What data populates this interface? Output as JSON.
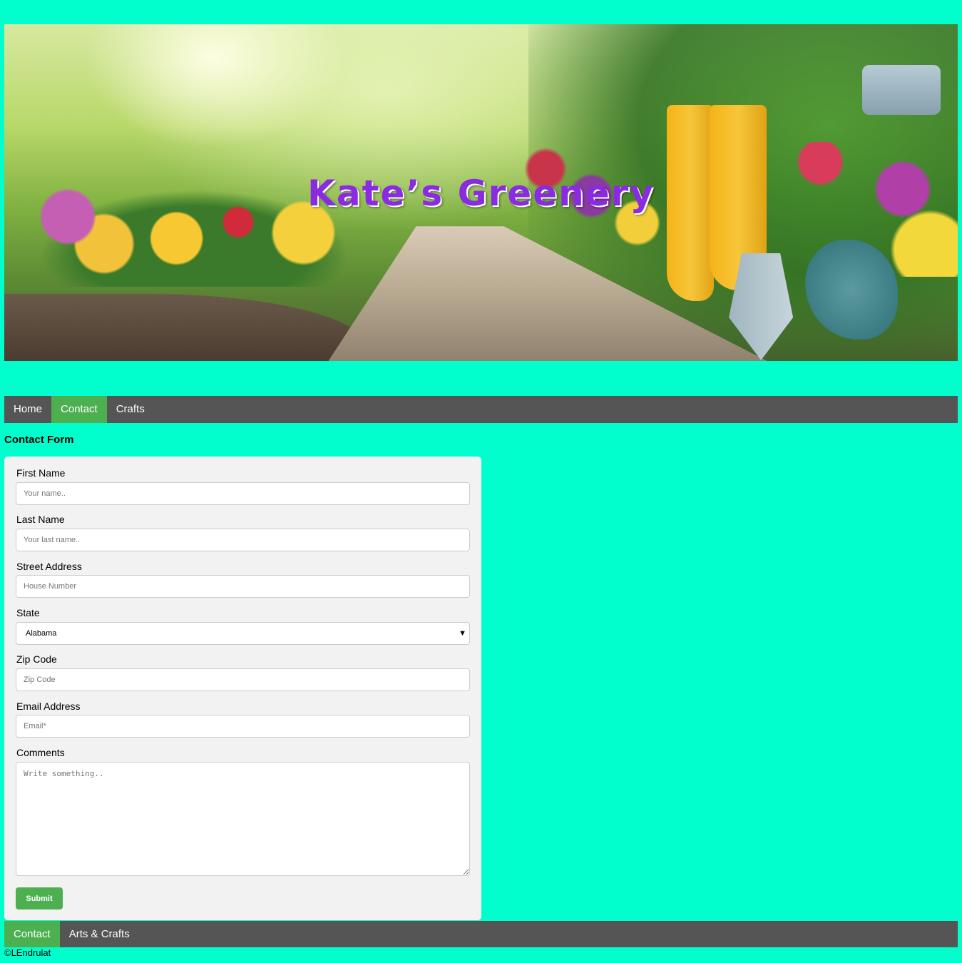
{
  "header": {
    "title": "Kate’s Greenery"
  },
  "nav": {
    "items": [
      {
        "label": "Home",
        "active": false
      },
      {
        "label": "Contact",
        "active": true
      },
      {
        "label": "Crafts",
        "active": false
      }
    ]
  },
  "form": {
    "heading": "Contact Form",
    "first_name": {
      "label": "First Name",
      "placeholder": "Your name.."
    },
    "last_name": {
      "label": "Last Name",
      "placeholder": "Your last name.."
    },
    "street": {
      "label": "Street Address",
      "placeholder": "House Number"
    },
    "state": {
      "label": "State",
      "selected": "Alabama"
    },
    "zip": {
      "label": "Zip Code",
      "placeholder": "Zip Code"
    },
    "email": {
      "label": "Email Address",
      "placeholder": "Email*"
    },
    "comments": {
      "label": "Comments",
      "placeholder": "Write something.."
    },
    "submit_label": "Submit"
  },
  "footer": {
    "items": [
      {
        "label": "Contact",
        "active": true
      },
      {
        "label": "Arts & Crafts",
        "active": false
      }
    ],
    "copyright": "©LEndrulat"
  },
  "colors": {
    "page_background": "#00ffcc",
    "nav_background": "#555555",
    "accent": "#4caf50",
    "title": "#8a2be2",
    "form_background": "#f2f2f2"
  }
}
